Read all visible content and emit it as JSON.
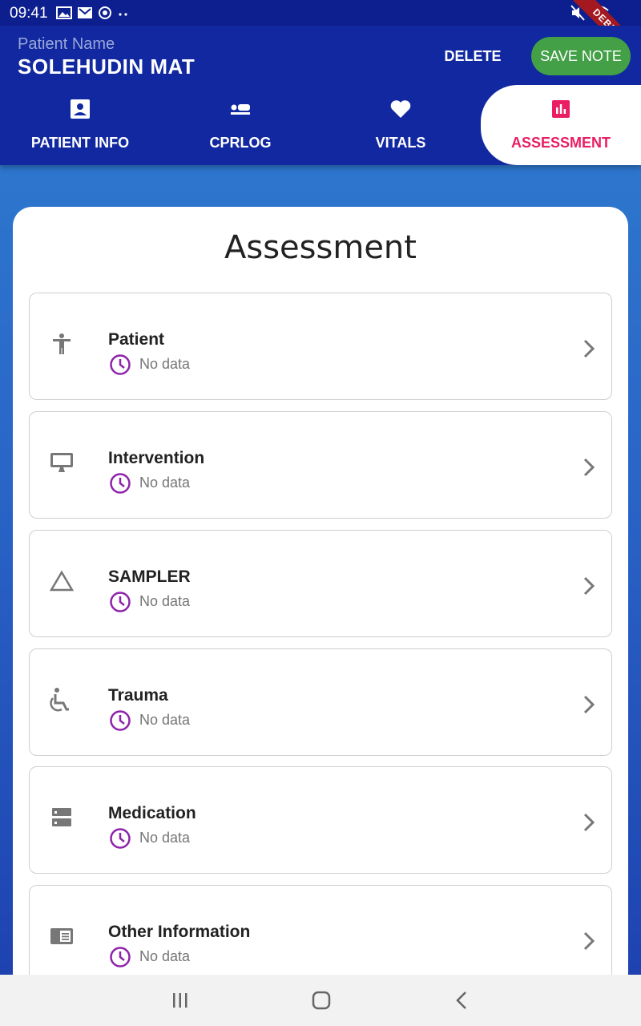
{
  "status_bar": {
    "time": "09:41",
    "debug_label": "DEBUG"
  },
  "header": {
    "patient_label": "Patient Name",
    "patient_name": "SOLEHUDIN MAT",
    "delete_label": "DELETE",
    "save_label": "SAVE NOTE",
    "save_color": "#43a047"
  },
  "tabs": [
    {
      "label": "PATIENT INFO",
      "icon": "account-box-icon",
      "active": false
    },
    {
      "label": "CPRLOG",
      "icon": "airline-seat-flat-icon",
      "active": false
    },
    {
      "label": "VITALS",
      "icon": "heart-icon",
      "active": false
    },
    {
      "label": "ASSESSMENT",
      "icon": "bar-chart-icon",
      "active": true
    }
  ],
  "accent_color": "#e91e63",
  "card": {
    "title": "Assessment",
    "items": [
      {
        "title": "Patient",
        "status": "No data",
        "icon": "accessibility-icon"
      },
      {
        "title": "Intervention",
        "status": "No data",
        "icon": "monitor-icon"
      },
      {
        "title": "SAMPLER",
        "status": "No data",
        "icon": "triangle-icon"
      },
      {
        "title": "Trauma",
        "status": "No data",
        "icon": "wheelchair-icon"
      },
      {
        "title": "Medication",
        "status": "No data",
        "icon": "storage-icon"
      },
      {
        "title": "Other Information",
        "status": "No data",
        "icon": "article-icon"
      }
    ]
  },
  "nav": [
    "recent-apps-icon",
    "home-icon",
    "back-icon"
  ]
}
